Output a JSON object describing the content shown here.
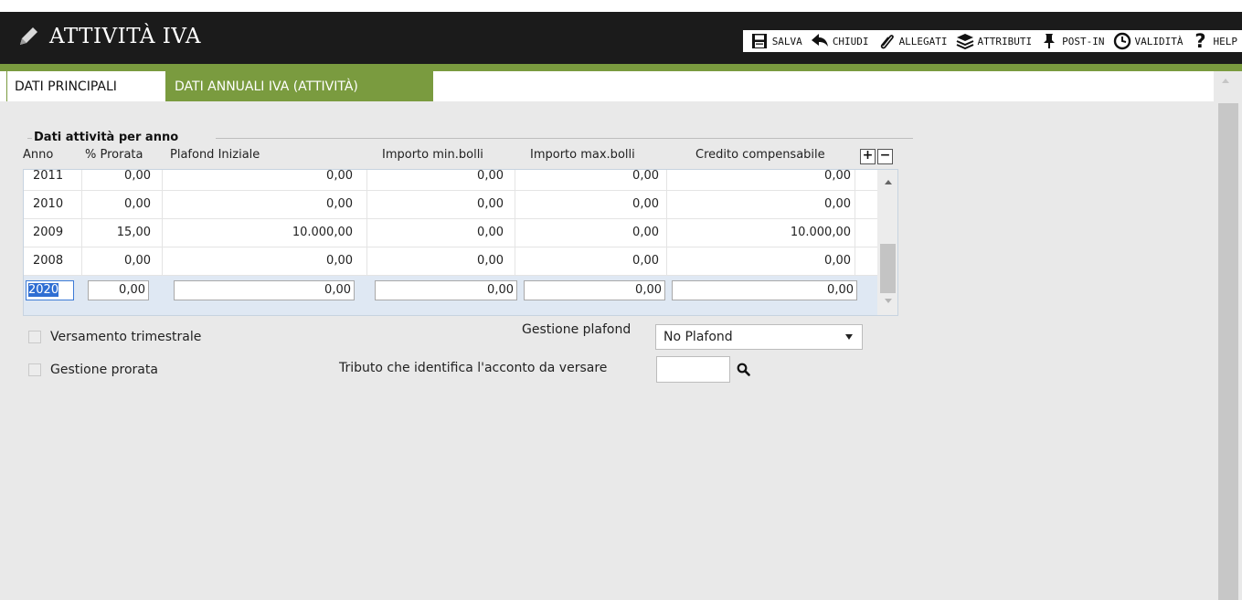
{
  "header": {
    "title": "ATTIVITÀ IVA"
  },
  "toolbar": {
    "items": [
      {
        "label": "SALVA",
        "icon": "save-icon"
      },
      {
        "label": "CHIUDI",
        "icon": "reply-icon"
      },
      {
        "label": "ALLEGATI",
        "icon": "paperclip-icon"
      },
      {
        "label": "ATTRIBUTI",
        "icon": "layers-icon"
      },
      {
        "label": "POST-IN",
        "icon": "pin-icon"
      },
      {
        "label": "VALIDITÀ",
        "icon": "clock-icon"
      },
      {
        "label": "HELP",
        "icon": "help-icon"
      }
    ]
  },
  "tabs": [
    {
      "label": "DATI PRINCIPALI",
      "active": false
    },
    {
      "label": "DATI ANNUALI IVA (ATTIVITÀ)",
      "active": true
    }
  ],
  "section": {
    "legend": "Dati attività per anno",
    "columns": [
      "Anno",
      "% Prorata",
      "Plafond Iniziale",
      "Importo min.bolli",
      "Importo max.bolli",
      "Credito compensabile"
    ],
    "add_label": "+",
    "remove_label": "−"
  },
  "rows": [
    [
      "2011",
      "0,00",
      "0,00",
      "0,00",
      "0,00",
      "0,00"
    ],
    [
      "2010",
      "0,00",
      "0,00",
      "0,00",
      "0,00",
      "0,00"
    ],
    [
      "2009",
      "15,00",
      "10.000,00",
      "0,00",
      "0,00",
      "10.000,00"
    ],
    [
      "2008",
      "0,00",
      "0,00",
      "0,00",
      "0,00",
      "0,00"
    ]
  ],
  "edit_row": [
    "2020",
    "0,00",
    "0,00",
    "0,00",
    "0,00",
    "0,00"
  ],
  "options": {
    "versamento_label": "Versamento trimestrale",
    "versamento_checked": false,
    "prorata_label": "Gestione prorata",
    "prorata_checked": false,
    "plafond_label": "Gestione plafond",
    "plafond_value": "No Plafond",
    "tributo_label": "Tributo che identifica l'acconto da versare",
    "tributo_value": ""
  },
  "colors": {
    "header_bg": "#1b1b1b",
    "accent_green": "#7a9b3f",
    "selected_row": "#dfe8f3"
  }
}
